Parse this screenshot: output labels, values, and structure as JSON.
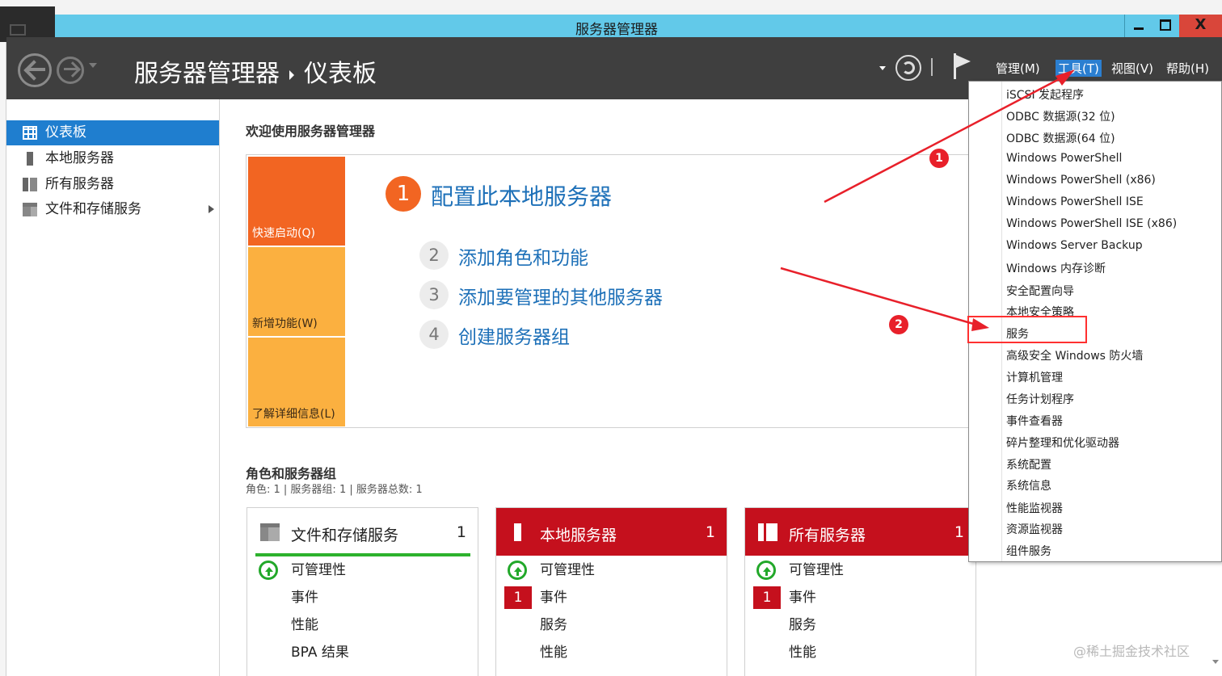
{
  "window": {
    "title": "服务器管理器",
    "controls": {
      "minimize": "",
      "maximize": "",
      "close": "X"
    }
  },
  "header": {
    "breadcrumb_root": "服务器管理器",
    "breadcrumb_page": "仪表板",
    "menus": [
      {
        "label": "管理(M)"
      },
      {
        "label": "工具(T)",
        "active": true
      },
      {
        "label": "视图(V)"
      },
      {
        "label": "帮助(H)"
      }
    ]
  },
  "sidebar": {
    "items": [
      {
        "label": "仪表板",
        "icon": "dashboard-icon",
        "active": true
      },
      {
        "label": "本地服务器",
        "icon": "server-icon"
      },
      {
        "label": "所有服务器",
        "icon": "servers-icon"
      },
      {
        "label": "文件和存储服务",
        "icon": "files-icon",
        "expandable": true
      }
    ]
  },
  "main": {
    "welcome": "欢迎使用服务器管理器",
    "quick_start": {
      "tiles": [
        "快速启动(Q)",
        "新增功能(W)",
        "了解详细信息(L)"
      ],
      "primary_step": {
        "number": "1",
        "label": "配置此本地服务器"
      },
      "steps": [
        {
          "number": "2",
          "label": "添加角色和功能"
        },
        {
          "number": "3",
          "label": "添加要管理的其他服务器"
        },
        {
          "number": "4",
          "label": "创建服务器组"
        }
      ]
    },
    "roles": {
      "title": "角色和服务器组",
      "subtitle": "角色: 1 | 服务器组: 1 | 服务器总数: 1",
      "cards": [
        {
          "title": "文件和存储服务",
          "count": "1",
          "style": "normal",
          "rows": [
            {
              "label": "可管理性",
              "status": "ok"
            },
            {
              "label": "事件"
            },
            {
              "label": "性能"
            },
            {
              "label": "BPA 结果"
            }
          ]
        },
        {
          "title": "本地服务器",
          "count": "1",
          "style": "alert",
          "rows": [
            {
              "label": "可管理性",
              "status": "ok"
            },
            {
              "label": "事件",
              "badge": "1"
            },
            {
              "label": "服务"
            },
            {
              "label": "性能"
            }
          ]
        },
        {
          "title": "所有服务器",
          "count": "1",
          "style": "alert",
          "rows": [
            {
              "label": "可管理性",
              "status": "ok"
            },
            {
              "label": "事件",
              "badge": "1"
            },
            {
              "label": "服务"
            },
            {
              "label": "性能"
            }
          ]
        }
      ]
    }
  },
  "tools_menu": {
    "items": [
      "iSCSI 发起程序",
      "ODBC 数据源(32 位)",
      "ODBC 数据源(64 位)",
      "Windows PowerShell",
      "Windows PowerShell (x86)",
      "Windows PowerShell ISE",
      "Windows PowerShell ISE (x86)",
      "Windows Server Backup",
      "Windows 内存诊断",
      "安全配置向导",
      "本地安全策略",
      "服务",
      "高级安全 Windows 防火墙",
      "计算机管理",
      "任务计划程序",
      "事件查看器",
      "碎片整理和优化驱动器",
      "系统配置",
      "系统信息",
      "性能监视器",
      "资源监视器",
      "组件服务"
    ],
    "highlighted": "服务"
  },
  "annotations": {
    "markers": [
      "1",
      "2"
    ],
    "color": "#e8202a"
  },
  "watermark": "@稀土掘金技术社区",
  "colors": {
    "titlebar": "#62c9e9",
    "header": "#3f3f3f",
    "accent_blue": "#1f7ecf",
    "quick_start_orange": "#f26522",
    "quick_start_yellow": "#fbb040",
    "alert_red": "#c5101d",
    "ok_green": "#22a82a",
    "link_blue": "#1d70b8"
  }
}
